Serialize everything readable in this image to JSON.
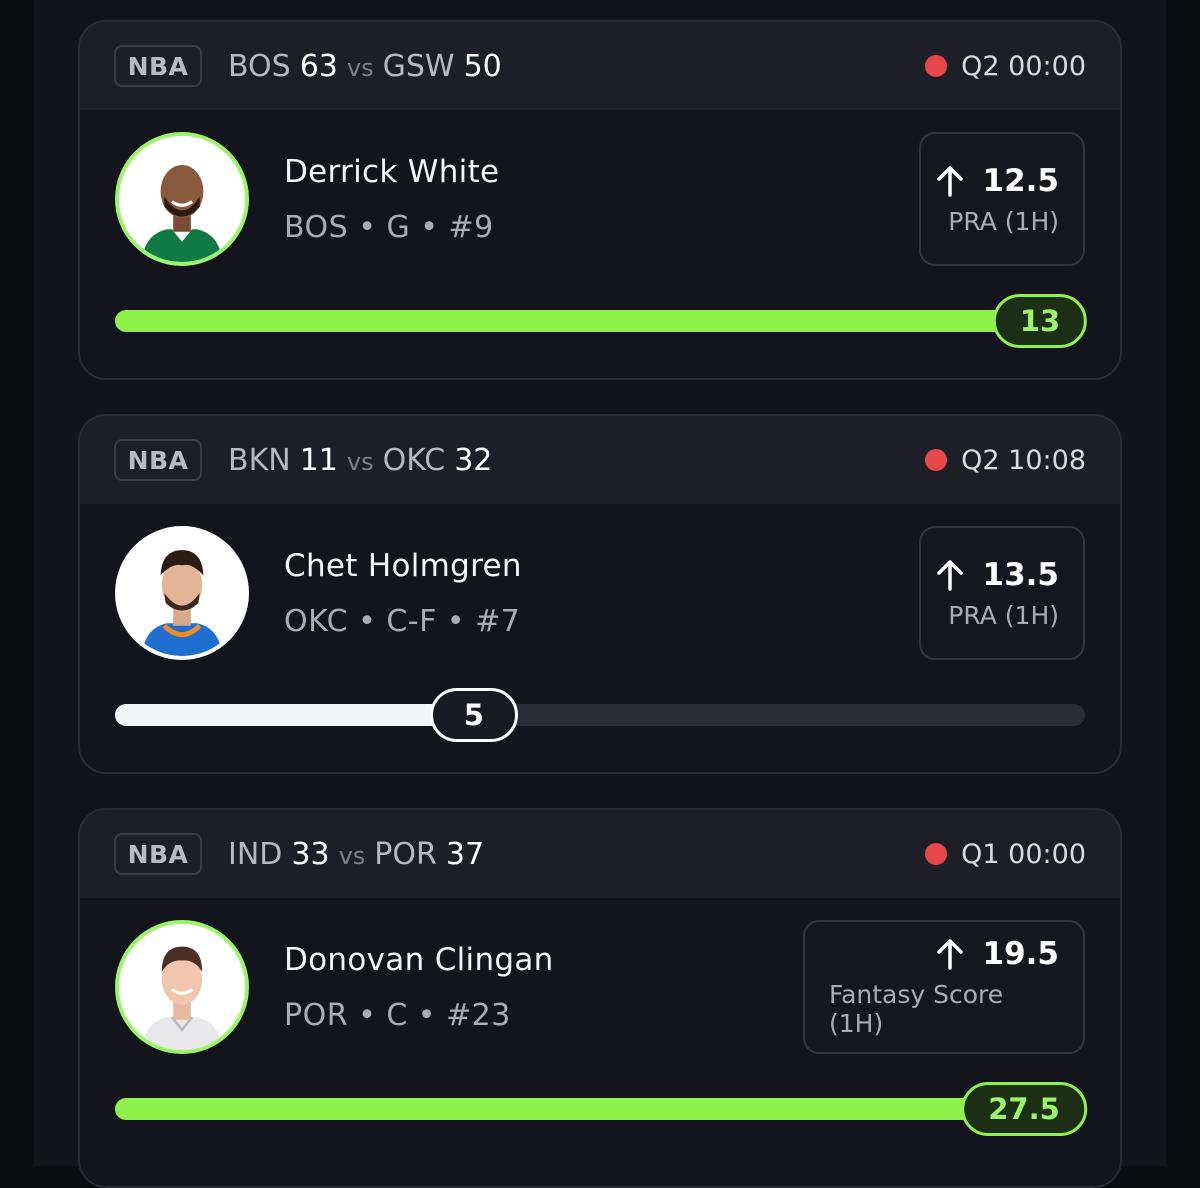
{
  "colors": {
    "accent_green": "#8ef24a",
    "live_red": "#e8474a",
    "card_bg": "#14151c",
    "header_bg": "#1e1f26"
  },
  "cards": [
    {
      "league": "NBA",
      "team1": "BOS",
      "score1": "63",
      "vs": "vs",
      "team2": "GSW",
      "score2": "50",
      "status": "Q2 00:00",
      "player_name": "Derrick White",
      "player_meta": "BOS • G • #9",
      "line_value": "12.5",
      "line_stat": "PRA (1H)",
      "direction_icon": "arrow-up-icon",
      "current_value": "13",
      "progress_fraction": 1.0,
      "jersey_color": "#0f7a45"
    },
    {
      "league": "NBA",
      "team1": "BKN",
      "score1": "11",
      "vs": "vs",
      "team2": "OKC",
      "score2": "32",
      "status": "Q2 10:08",
      "player_name": "Chet Holmgren",
      "player_meta": "OKC • C-F • #7",
      "line_value": "13.5",
      "line_stat": "PRA (1H)",
      "direction_icon": "arrow-up-icon",
      "current_value": "5",
      "progress_fraction": 0.37,
      "jersey_color": "#1d6fd1"
    },
    {
      "league": "NBA",
      "team1": "IND",
      "score1": "33",
      "vs": "vs",
      "team2": "POR",
      "score2": "37",
      "status": "Q1 00:00",
      "player_name": "Donovan Clingan",
      "player_meta": "POR • C • #23",
      "line_value": "19.5",
      "line_stat": "Fantasy Score (1H)",
      "direction_icon": "arrow-up-icon",
      "current_value": "27.5",
      "progress_fraction": 1.0,
      "jersey_color": "#e8e8ea"
    }
  ]
}
